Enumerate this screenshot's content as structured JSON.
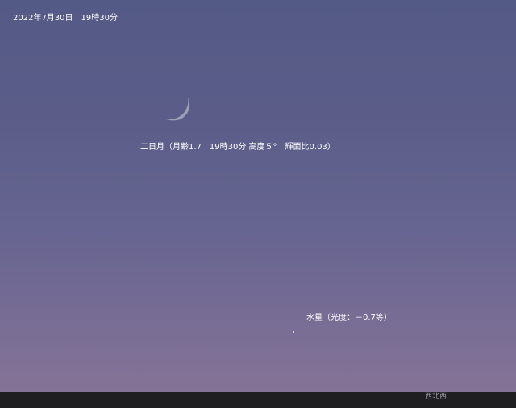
{
  "header": {
    "date_time": "2022年7月30日　19時30分"
  },
  "moon": {
    "label": "二日月（月齢1.7　19時30分 高度５°　輝面比0.03）"
  },
  "mercury": {
    "label": "水星（光度：－0.7等）"
  },
  "horizon": {
    "direction": "西北西"
  },
  "colors": {
    "sky_top": "#545a86",
    "sky_bottom": "#857396",
    "ground": "#1f1f22",
    "label_text": "#ffffff"
  }
}
